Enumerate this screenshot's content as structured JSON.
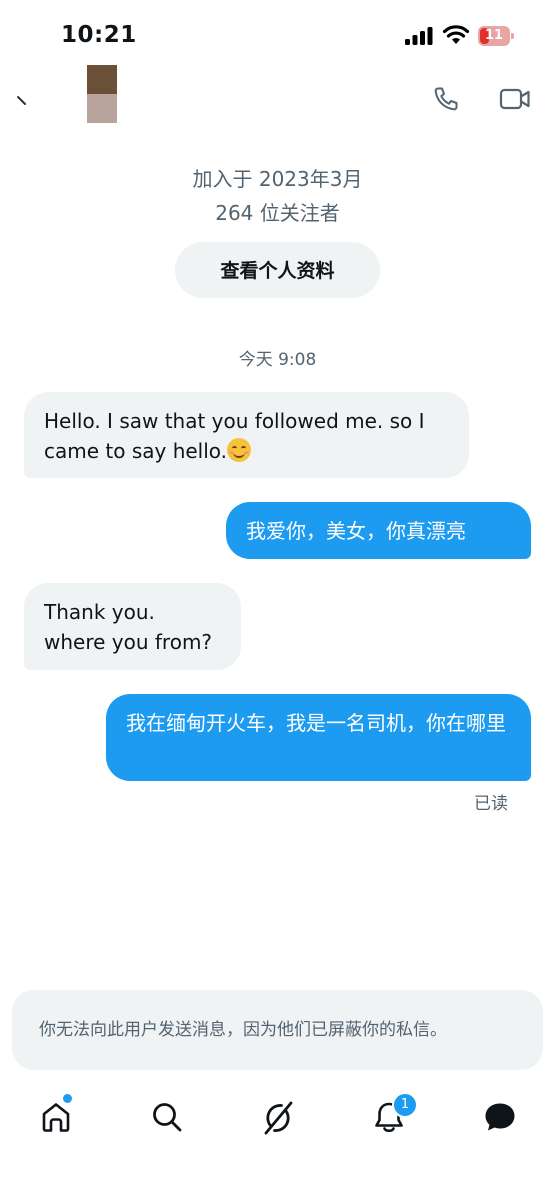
{
  "status_bar": {
    "time": "10:21",
    "battery_level": "11",
    "battery_color": "#e0312e"
  },
  "header": {
    "icons": [
      "back-icon",
      "phone-icon",
      "video-call-icon"
    ]
  },
  "profile": {
    "joined": "加入于 2023年3月",
    "followers": "264 位关注者",
    "view_profile_label": "查看个人资料"
  },
  "conversation": {
    "timestamp": "今天 9:08",
    "messages": [
      {
        "direction": "incoming",
        "text": "Hello. I saw that you followed me. so I came to say hello.",
        "emoji": "smiling-face-icon"
      },
      {
        "direction": "outgoing",
        "text": "我爱你，美女，你真漂亮"
      },
      {
        "direction": "incoming",
        "line1": "Thank you.",
        "line2": "where you from?"
      },
      {
        "direction": "outgoing",
        "text": "我在缅甸开火车，我是一名司机，你在哪里"
      }
    ],
    "read_receipt": "已读"
  },
  "blocked_notice": "你无法向此用户发送消息，因为他们已屏蔽你的私信。",
  "nav": {
    "items": [
      "home-icon",
      "search-icon",
      "grok-icon",
      "notifications-icon",
      "messages-icon"
    ],
    "notifications_badge": "1"
  },
  "colors": {
    "accent": "#1d9bf0",
    "bubble_incoming": "#eff3f4",
    "muted_text": "#536471"
  }
}
